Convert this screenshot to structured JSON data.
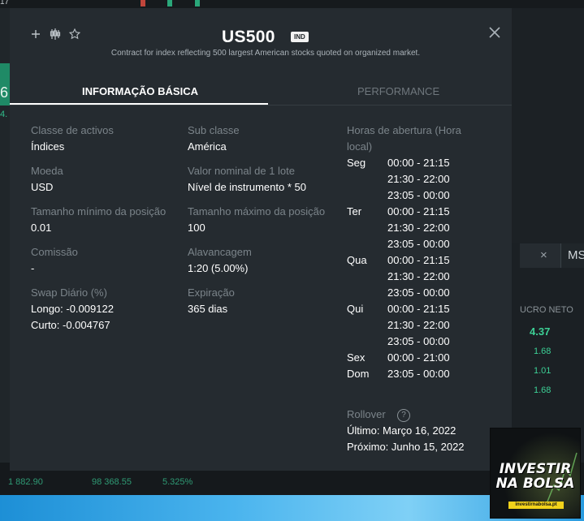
{
  "background": {
    "left_big_number": "6",
    "left_small": "4.",
    "tab_ms": "MS",
    "tab_close": "×",
    "lucro_header": "UCRO NETO",
    "lucro_main": "4.37",
    "lucro_values": [
      "1.68",
      "1.01",
      "1.68"
    ],
    "bottom_stats": [
      "1 882.90",
      "98 368.55",
      "5.325%"
    ],
    "top_partial": "17"
  },
  "dialog": {
    "title": "US500",
    "badge": "IND",
    "subtitle": "Contract for index reflecting 500 largest American stocks quoted on organized market.",
    "tabs": [
      "INFORMAÇÃO BÁSICA",
      "PERFORMANCE"
    ],
    "col1": [
      {
        "label": "Classe de activos",
        "value": "Índices"
      },
      {
        "label": "Moeda",
        "value": "USD"
      },
      {
        "label": "Tamanho mínimo da posição",
        "value": "0.01"
      },
      {
        "label": "Comissão",
        "value": "-"
      },
      {
        "label": "Swap Diário (%)",
        "value": "Longo: -0.009122"
      }
    ],
    "swap_short": "Curto: -0.004767",
    "col2": [
      {
        "label": "Sub classe",
        "value": "América"
      },
      {
        "label": "Valor nominal de 1 lote",
        "value": "Nível de instrumento * 50"
      },
      {
        "label": "Tamanho máximo da posição",
        "value": "100"
      },
      {
        "label": "Alavancagem",
        "value": "1:20 (5.00%)"
      },
      {
        "label": "Expiração",
        "value": "365 dias"
      }
    ],
    "hours_title": "Horas de abertura (Hora local)",
    "schedule": [
      {
        "day": "Seg",
        "slots": [
          "00:00 - 21:15",
          "21:30 - 22:00",
          "23:05 - 00:00"
        ]
      },
      {
        "day": "Ter",
        "slots": [
          "00:00 - 21:15",
          "21:30 - 22:00",
          "23:05 - 00:00"
        ]
      },
      {
        "day": "Qua",
        "slots": [
          "00:00 - 21:15",
          "21:30 - 22:00",
          "23:05 - 00:00"
        ]
      },
      {
        "day": "Qui",
        "slots": [
          "00:00 - 21:15",
          "21:30 - 22:00",
          "23:05 - 00:00"
        ]
      },
      {
        "day": "Sex",
        "slots": [
          "00:00 - 21:00"
        ]
      },
      {
        "day": "Dom",
        "slots": [
          "23:05 - 00:00"
        ]
      }
    ],
    "rollover_label": "Rollover",
    "rollover_last": "Último: Março 16, 2022",
    "rollover_next": "Próximo: Junho 15, 2022"
  },
  "promo": {
    "line1": "INVESTIR",
    "line2": "NA BOLSA",
    "url": "investirnabolsa.pt"
  },
  "icons": {
    "add": "plus-icon",
    "chart": "candlestick-icon",
    "favorite": "star-icon",
    "close": "close-icon",
    "help": "help-icon"
  }
}
